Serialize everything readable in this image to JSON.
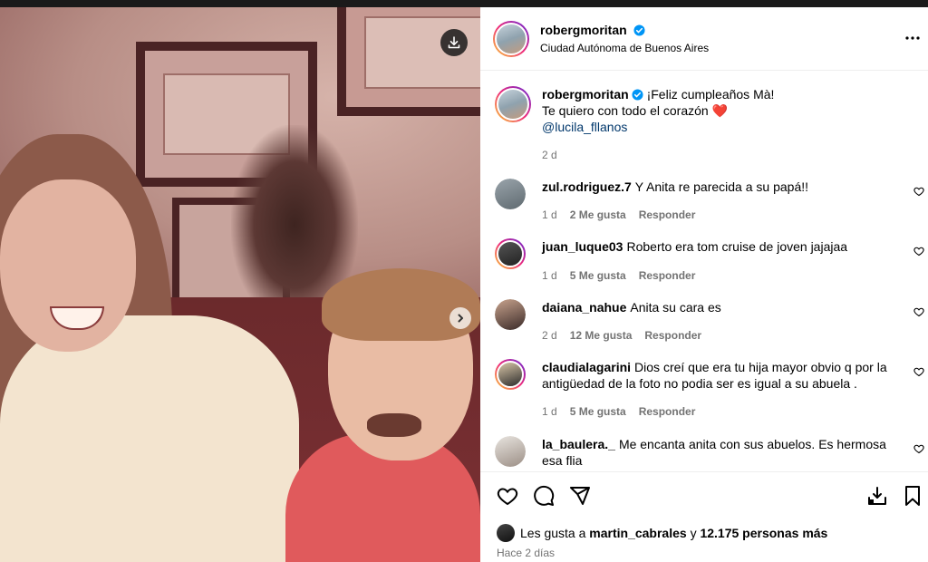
{
  "post": {
    "username": "robergmoritan",
    "location": "Ciudad Autónoma de Buenos Aires",
    "caption_lines": [
      "¡Feliz cumpleaños Mà!",
      "Te quiero con todo el corazón"
    ],
    "caption_emoji": "❤️",
    "mention": "@lucila_fllanos",
    "caption_time": "2 d"
  },
  "comments": [
    {
      "username": "zul.rodriguez.7",
      "text": "Y Anita re parecida a su papá!!",
      "time": "1 d",
      "likes": "2 Me gusta",
      "reply": "Responder"
    },
    {
      "username": "juan_luque03",
      "text": "Roberto era tom cruise de joven jajajaa",
      "time": "1 d",
      "likes": "5 Me gusta",
      "reply": "Responder"
    },
    {
      "username": "daiana_nahue",
      "text": "Anita su cara es",
      "time": "2 d",
      "likes": "12 Me gusta",
      "reply": "Responder"
    },
    {
      "username": "claudialagarini",
      "text": "Dios creí que era tu hija mayor obvio q por la antigüedad de la foto no podia ser es igual a su abuela .",
      "time": "1 d",
      "likes": "5 Me gusta",
      "reply": "Responder"
    },
    {
      "username": "la_baulera._",
      "text": "Me encanta anita con sus abuelos. Es hermosa esa flia",
      "time": "",
      "likes": "",
      "reply": ""
    }
  ],
  "footer": {
    "likes_prefix": "Les gusta a",
    "liked_by": "martin_cabrales",
    "likes_and": "y",
    "likes_count": "12.175 personas más",
    "posted_ago": "Hace 2 días"
  },
  "icons": {
    "download": "download-icon",
    "next": "chevron-right-icon",
    "more": "more-options-icon",
    "verified": "verified-badge-icon",
    "like": "heart-icon",
    "comment": "comment-icon",
    "share": "share-icon",
    "save_to_collection": "save-to-collection-icon",
    "bookmark": "bookmark-icon"
  },
  "colors": {
    "verified": "#0095f6",
    "mention": "#00376b",
    "heart_red": "#e0245e",
    "muted": "#737373"
  }
}
